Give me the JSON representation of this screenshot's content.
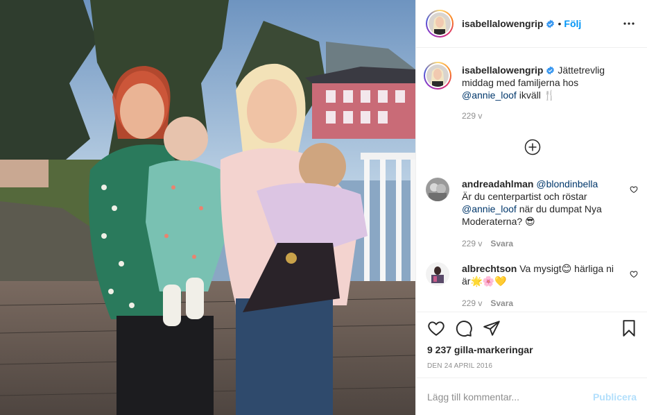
{
  "post": {
    "author": "isabellalowengrip",
    "follow_label": "Följ",
    "separator": "•",
    "image_alt": "Two women holding babies outdoors on a wooden deck"
  },
  "caption": {
    "username": "isabellalowengrip",
    "text_before": " Jättetrevlig middag med familjerna hos ",
    "mention": "@annie_loof",
    "text_after": " ikväll 🍴",
    "time": "229 v"
  },
  "comments": [
    {
      "username": "andreadahlman",
      "mention": "@blondinbella",
      "text_1": "Är du centerpartist och röstar ",
      "mention_2": "@annie_loof",
      "text_2": " när du dumpat Nya Moderaterna? 😎",
      "time": "229 v",
      "reply_label": "Svara"
    },
    {
      "username": "albrechtson",
      "text": " Va mysigt😊 härliga ni är🌟🌸💛",
      "time": "229 v",
      "reply_label": "Svara"
    }
  ],
  "likes": "9 237 gilla-markeringar",
  "date": "DEN 24 APRIL 2016",
  "comment_input": {
    "placeholder": "Lägg till kommentar...",
    "publish_label": "Publicera"
  },
  "colors": {
    "link_blue": "#0095f6",
    "mention_blue": "#00376b",
    "muted": "#8e8e8e",
    "publish_disabled": "#b2dffc",
    "divider": "#efefef"
  },
  "icons": [
    "verified-badge-icon",
    "more-options-icon",
    "load-more-icon",
    "heart-icon",
    "comment-icon",
    "share-icon",
    "bookmark-icon"
  ]
}
